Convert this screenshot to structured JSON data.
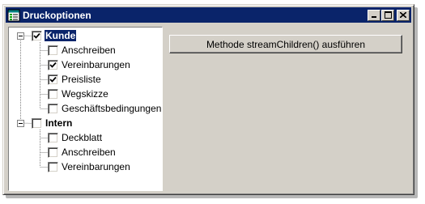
{
  "window": {
    "title": "Druckoptionen",
    "icon": "tree-view-app-icon",
    "controls": [
      "minimize",
      "maximize",
      "close"
    ]
  },
  "tree": {
    "nodes": [
      {
        "label": "Kunde",
        "checked": true,
        "bold": true,
        "selected": true,
        "expanded": true,
        "children": [
          {
            "label": "Anschreiben",
            "checked": false
          },
          {
            "label": "Vereinbarungen",
            "checked": true
          },
          {
            "label": "Preisliste",
            "checked": true
          },
          {
            "label": "Wegskizze",
            "checked": false
          },
          {
            "label": "Geschäftsbedingungen",
            "checked": false
          }
        ]
      },
      {
        "label": "Intern",
        "checked": false,
        "bold": true,
        "selected": false,
        "expanded": true,
        "children": [
          {
            "label": "Deckblatt",
            "checked": false
          },
          {
            "label": "Anschreiben",
            "checked": false
          },
          {
            "label": "Vereinbarungen",
            "checked": false
          }
        ]
      }
    ]
  },
  "main": {
    "button_label": "Methode streamChildren() ausführen"
  },
  "colors": {
    "titlebar": "#0a246a",
    "face": "#d4d0c8",
    "selection": "#0a246a"
  }
}
